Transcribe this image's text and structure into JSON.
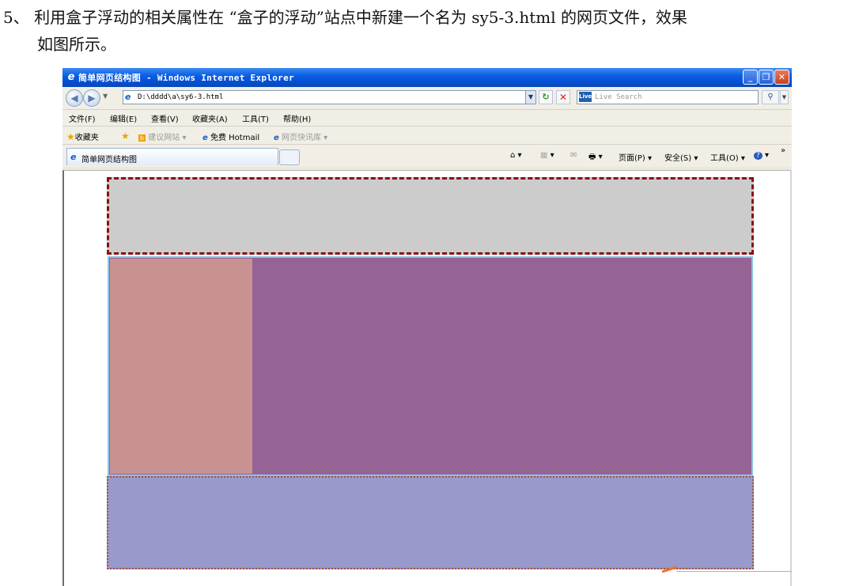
{
  "document": {
    "line1": "5、 利用盒子浮动的相关属性在 “盒子的浮动”站点中新建一个名为 sy5-3.html 的网页文件，效果",
    "line2": "如图所示。"
  },
  "window": {
    "title": "简单网页结构图 - Windows Internet Explorer",
    "buttons": {
      "minimize": "_",
      "maximize": "❐",
      "close": "✕"
    }
  },
  "addressbar": {
    "url": "D:\\dddd\\a\\sy6-3.html",
    "search_placeholder": "Live Search",
    "live_icon": "Live"
  },
  "menu": [
    "文件(F)",
    "编辑(E)",
    "查看(V)",
    "收藏夹(A)",
    "工具(T)",
    "帮助(H)"
  ],
  "favorites": {
    "favorites_label": "收藏夹",
    "suggested_sites": "建议网站 ▾",
    "hotmail": "免费 Hotmail",
    "web_slice": "网页快讯库 ▾"
  },
  "tab": {
    "label": "简单网页结构图"
  },
  "commands": {
    "home": "▾",
    "feeds": "▾",
    "print": "▾",
    "page": "页面(P) ▾",
    "safety": "安全(S) ▾",
    "tools": "工具(O) ▾",
    "help": "▾",
    "more": "»"
  },
  "colors": {
    "header_bg": "#cccccc",
    "header_border": "#8b0f0f",
    "main_bg": "#946494",
    "main_border": "#8cc3e6",
    "left_bg": "#c89292",
    "footer_bg": "#9999cc",
    "footer_border": "#a0522d"
  }
}
